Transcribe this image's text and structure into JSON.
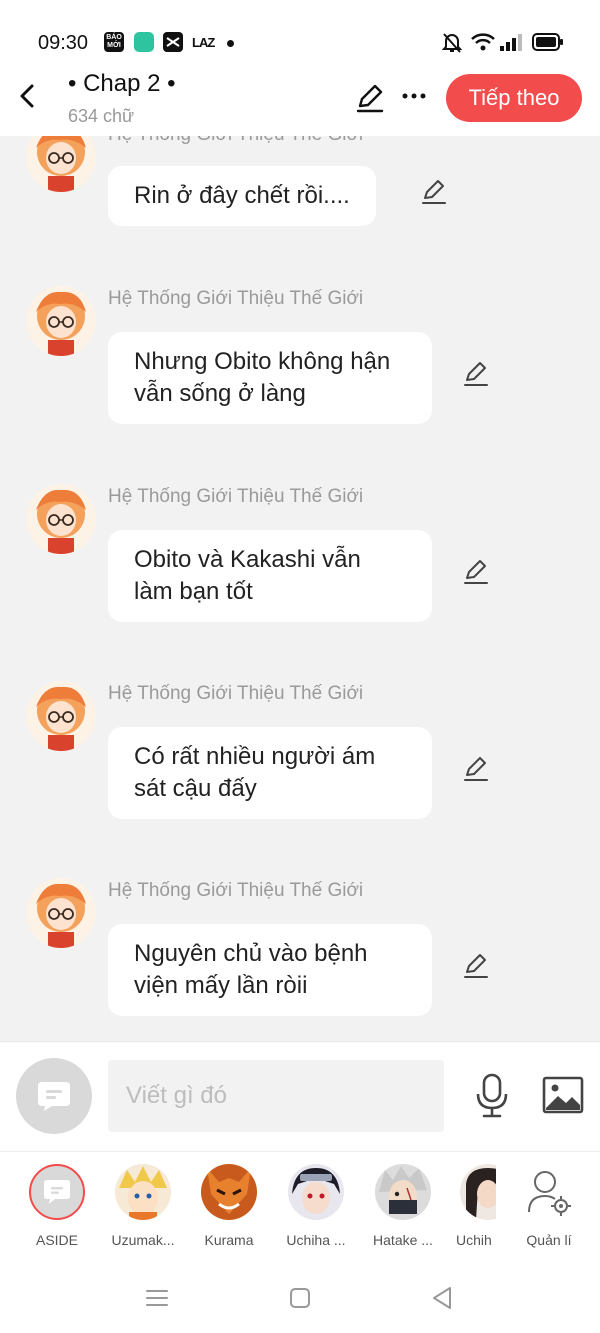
{
  "status_bar": {
    "time": "09:30",
    "app_icons": [
      "BÁO MỚI",
      "LAZ"
    ]
  },
  "header": {
    "chapter_title": "• Chap 2 •",
    "word_count": "634 chữ",
    "next_label": "Tiếp theo",
    "accent_color": "#f24c4c"
  },
  "messages": [
    {
      "sender": "Hệ Thống Giới Thiệu Thế Giới",
      "text": "Rin ở đây chết rồi...."
    },
    {
      "sender": "Hệ Thống Giới Thiệu Thế Giới",
      "text": "Nhưng Obito không hận vẫn sống ở làng"
    },
    {
      "sender": "Hệ Thống Giới Thiệu Thế Giới",
      "text": "Obito và Kakashi vẫn làm bạn tốt"
    },
    {
      "sender": "Hệ Thống Giới Thiệu Thế Giới",
      "text": "Có rất nhiều người ám sát cậu đấy"
    },
    {
      "sender": "Hệ Thống Giới Thiệu Thế Giới",
      "text": "Nguyên chủ vào bệnh viện mấy lần ròii"
    }
  ],
  "input": {
    "placeholder": "Viết gì đó"
  },
  "characters": [
    {
      "name": "ASIDE"
    },
    {
      "name": "Uzumak..."
    },
    {
      "name": "Kurama"
    },
    {
      "name": "Uchiha ..."
    },
    {
      "name": "Hatake ..."
    },
    {
      "name": "Uchih"
    }
  ],
  "manage_label": "Quản lí",
  "icons": [
    "back-icon",
    "pen-icon",
    "more-icon",
    "mic-icon",
    "image-icon",
    "manage-user-icon",
    "menu-icon",
    "home-icon",
    "back-triangle-icon"
  ]
}
